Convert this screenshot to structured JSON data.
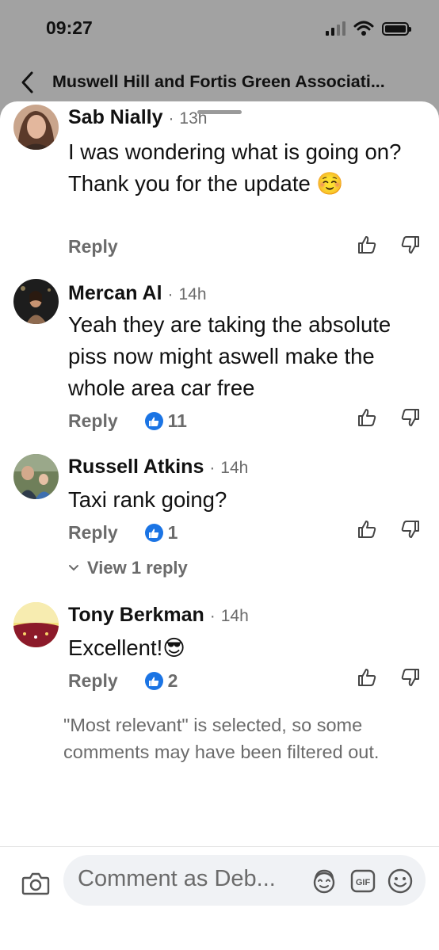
{
  "status": {
    "time": "09:27"
  },
  "header": {
    "title": "Muswell Hill and Fortis Green Associati..."
  },
  "comments": [
    {
      "name": "Sab Nially",
      "dot": "·",
      "time": "13h",
      "text": "I was wondering what is going on? Thank you for the update ☺️",
      "reply_label": "Reply",
      "reaction_count": ""
    },
    {
      "name": "Mercan Al",
      "dot": "·",
      "time": "14h",
      "text": "Yeah they are taking the absolute piss now might aswell make the whole area car free",
      "reply_label": "Reply",
      "reaction_count": "11"
    },
    {
      "name": "Russell Atkins",
      "dot": "·",
      "time": "14h",
      "text": "Taxi rank going?",
      "reply_label": "Reply",
      "reaction_count": "1",
      "view_replies": "View 1 reply"
    },
    {
      "name": "Tony Berkman",
      "dot": "·",
      "time": "14h",
      "text": "Excellent!😎",
      "reply_label": "Reply",
      "reaction_count": "2"
    }
  ],
  "filter_note": "\"Most relevant\" is selected, so some comments may have been filtered out.",
  "composer": {
    "placeholder": "Comment as Deb..."
  },
  "colors": {
    "accent": "#1b74e4",
    "secondary_text": "#6b6b6b",
    "input_bg": "#f0f2f5",
    "backdrop": "#a2a2a2"
  },
  "icons": [
    "back-chevron-icon",
    "like-outline-icon",
    "dislike-outline-icon",
    "like-badge-icon",
    "chevron-down-icon",
    "camera-icon",
    "avatar-sticker-icon",
    "gif-icon",
    "emoji-icon"
  ]
}
